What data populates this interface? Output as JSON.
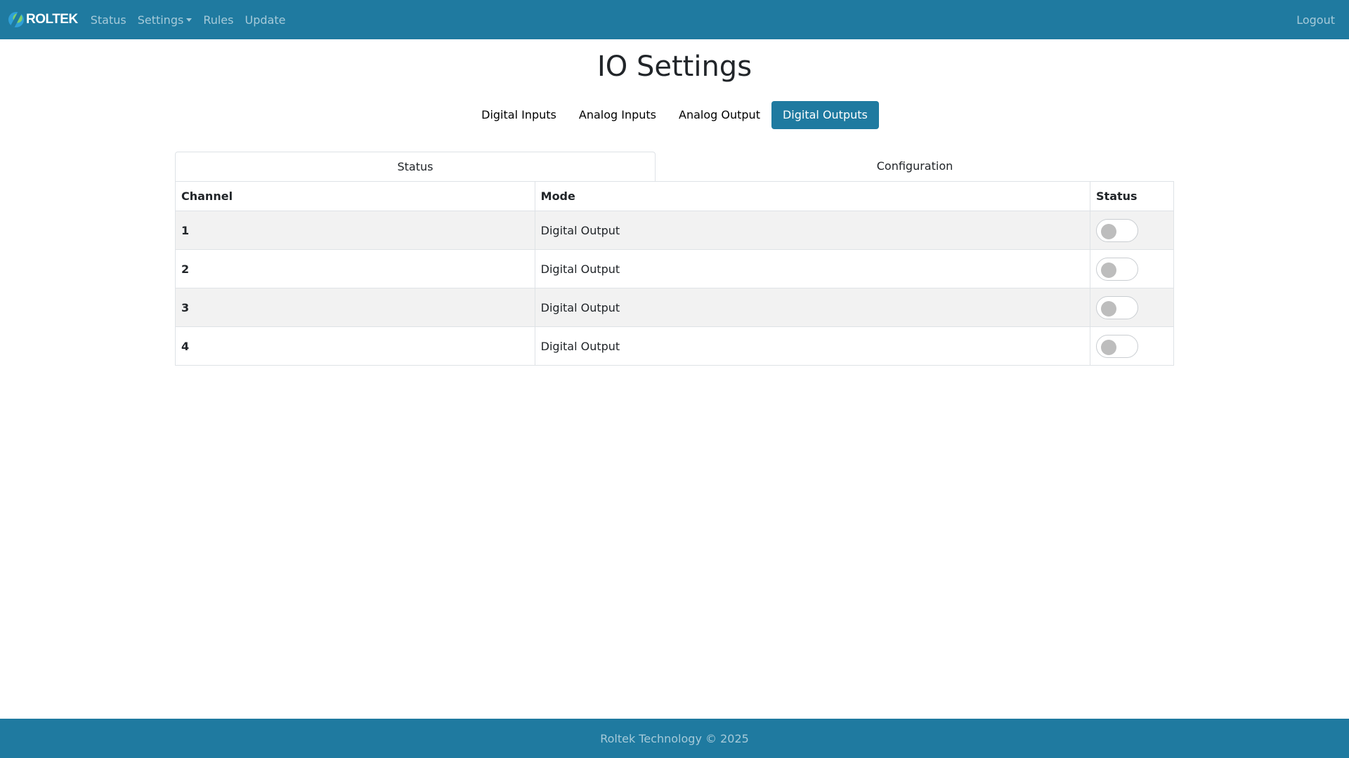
{
  "navbar": {
    "brand": "ROLTEK",
    "links": [
      {
        "label": "Status"
      },
      {
        "label": "Settings",
        "dropdown": true
      },
      {
        "label": "Rules"
      },
      {
        "label": "Update"
      }
    ],
    "logout": "Logout"
  },
  "page": {
    "title": "IO Settings"
  },
  "pills": [
    {
      "label": "Digital Inputs",
      "active": false
    },
    {
      "label": "Analog Inputs",
      "active": false
    },
    {
      "label": "Analog Output",
      "active": false
    },
    {
      "label": "Digital Outputs",
      "active": true
    }
  ],
  "tabs": [
    {
      "label": "Status",
      "active": true
    },
    {
      "label": "Configuration",
      "active": false
    }
  ],
  "table": {
    "headers": [
      "Channel",
      "Mode",
      "Status"
    ],
    "rows": [
      {
        "channel": "1",
        "mode": "Digital Output",
        "on": false
      },
      {
        "channel": "2",
        "mode": "Digital Output",
        "on": false
      },
      {
        "channel": "3",
        "mode": "Digital Output",
        "on": false
      },
      {
        "channel": "4",
        "mode": "Digital Output",
        "on": false
      }
    ]
  },
  "footer": {
    "text": "Roltek Technology © 2025"
  },
  "colors": {
    "primary": "#1f7aa0",
    "stripe": "#f2f2f2",
    "border": "#dee2e6"
  }
}
